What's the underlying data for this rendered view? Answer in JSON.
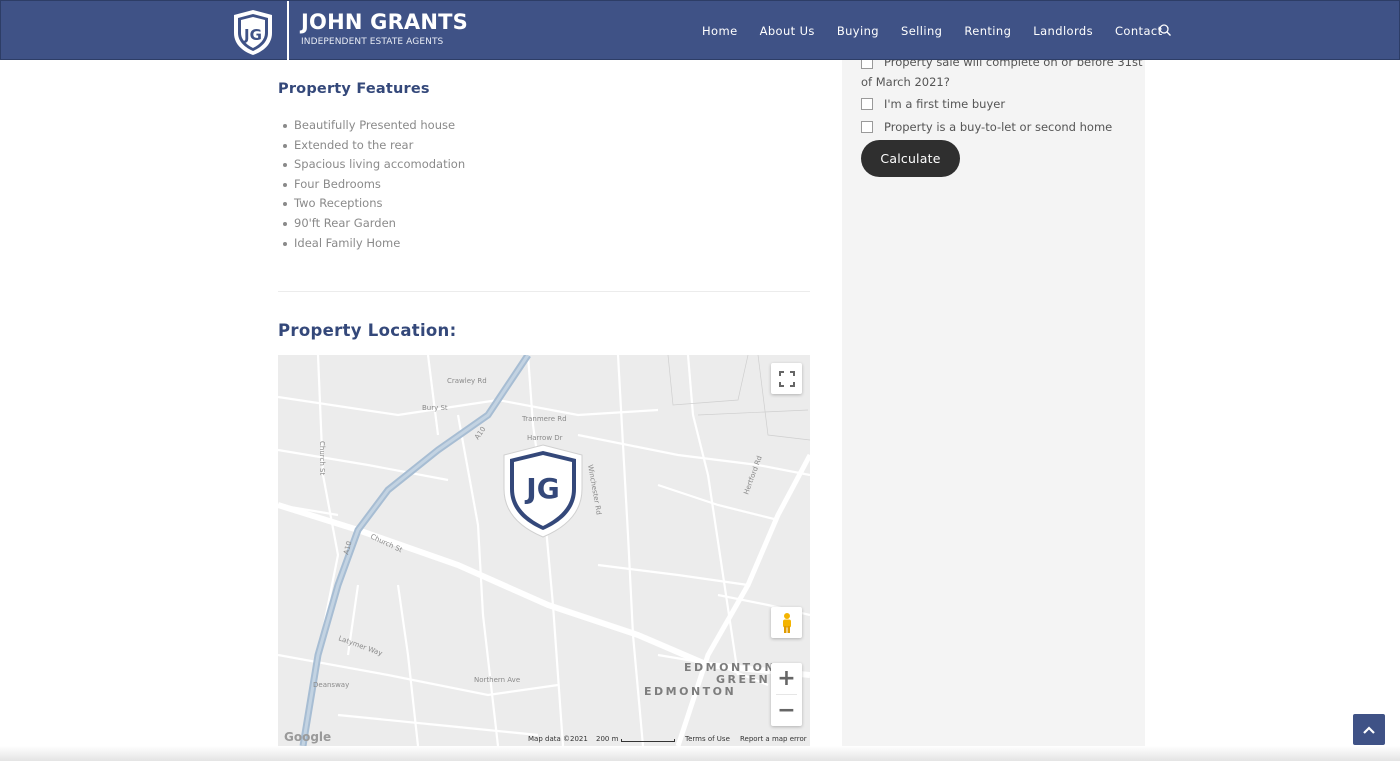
{
  "header": {
    "logo_initials": "JG",
    "brand_name": "JOHN GRANTS",
    "brand_tagline": "INDEPENDENT ESTATE AGENTS",
    "nav": [
      "Home",
      "About Us",
      "Buying",
      "Selling",
      "Renting",
      "Landlords",
      "Contact"
    ],
    "search_icon": "search-icon",
    "brand_color": "#3f5286"
  },
  "features": {
    "title": "Property Features",
    "items": [
      "Beautifully Presented house",
      "Extended to the rear",
      "Spacious living accomodation",
      "Four Bedrooms",
      "Two Receptions",
      "90'ft Rear Garden",
      "Ideal Family Home"
    ]
  },
  "location": {
    "title": "Property Location:",
    "map": {
      "marker_initials": "JG",
      "area_label_1": "EDMONTON",
      "area_label_2": "GREEN",
      "area_label_3": "EDMONTON",
      "road_labels": [
        "A10",
        "A10",
        "Church St",
        "Church St",
        "Hertford Rd",
        "Bury St",
        "Crawley Rd",
        "Tranmere Rd",
        "Harrow Dr",
        "Winchester Rd",
        "Latymer Way",
        "Northern Ave",
        "Deansway"
      ],
      "google": "Google",
      "map_data": "Map data ©2021",
      "scale": "200 m",
      "terms": "Terms of Use",
      "report": "Report a map error"
    }
  },
  "sidebar": {
    "checkbox_1_line1": "Property sale will complete on or before 31st",
    "checkbox_1_line2": "of March 2021?",
    "checkbox_2": "I'm a first time buyer",
    "checkbox_3": "Property is a buy-to-let or second home",
    "calculate_label": "Calculate"
  }
}
